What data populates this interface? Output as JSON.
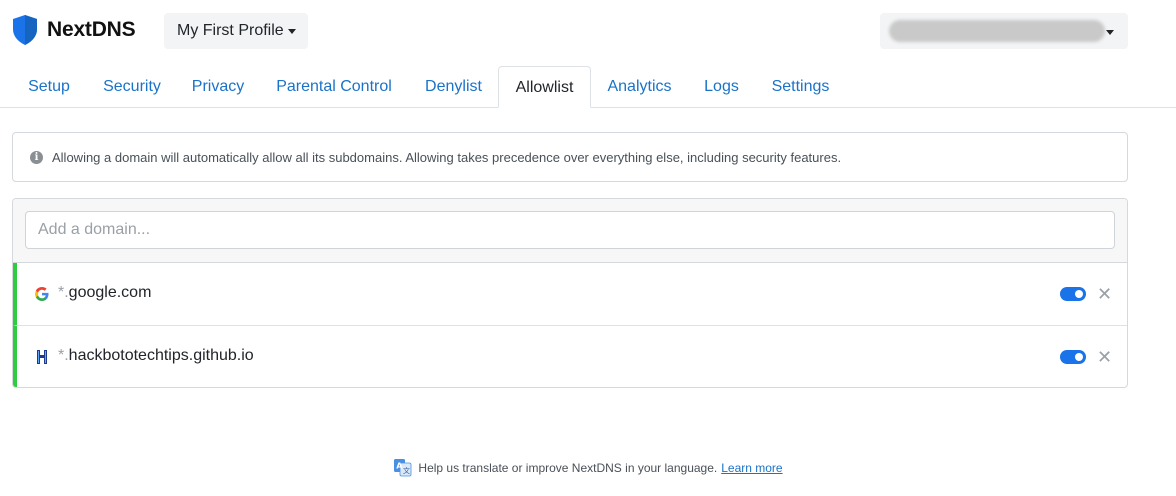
{
  "brand": {
    "name": "NextDNS",
    "accent": "#1a73e8"
  },
  "profile": {
    "label": "My First Profile"
  },
  "tabs": [
    {
      "label": "Setup"
    },
    {
      "label": "Security"
    },
    {
      "label": "Privacy"
    },
    {
      "label": "Parental Control"
    },
    {
      "label": "Denylist"
    },
    {
      "label": "Allowlist",
      "active": true
    },
    {
      "label": "Analytics"
    },
    {
      "label": "Logs"
    },
    {
      "label": "Settings"
    }
  ],
  "info": {
    "text": "Allowing a domain will automatically allow all its subdomains. Allowing takes precedence over everything else, including security features.",
    "icon": "info-icon"
  },
  "add": {
    "placeholder": "Add a domain..."
  },
  "entries": [
    {
      "prefix": "*.",
      "domain": "google.com",
      "icon": "google-favicon-icon",
      "enabled": true
    },
    {
      "prefix": "*.",
      "domain": "hackbototechtips.github.io",
      "icon": "hackbot-favicon-icon",
      "enabled": true
    }
  ],
  "footer": {
    "text": "Help us translate or improve NextDNS in your language.",
    "link": "Learn more"
  },
  "colors": {
    "active_row_marker": "#2ecc40",
    "toggle_on": "#1a73e8",
    "link": "#1a73c8"
  }
}
